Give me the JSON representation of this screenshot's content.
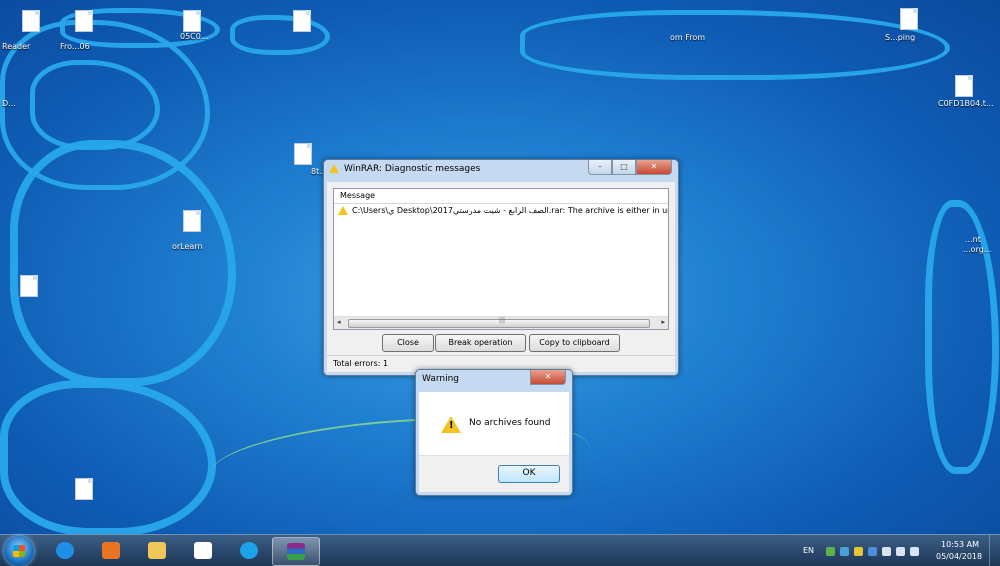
{
  "desktop": {
    "icon_labels": [
      "Reader",
      "Fro...06",
      "05C0...",
      "om From",
      "S...ping",
      "C0FD1B04.t...",
      "D...",
      "8t...",
      "orLearn",
      "...nt",
      "...org..."
    ]
  },
  "diagnostic_window": {
    "title": "WinRAR: Diagnostic messages",
    "minimize": "–",
    "maximize": "□",
    "close": "✕",
    "column_header": "Message",
    "message_row": "C:\\Users\\ي                 Desktop\\الصف الرابع - شيت  مدرستي2017.rar: The archive is either in unk",
    "scroll_left": "◂",
    "scroll_right": "▸",
    "buttons": {
      "close": "Close",
      "break": "Break operation",
      "copy": "Copy to clipboard"
    },
    "status": "Total errors: 1"
  },
  "warning_dialog": {
    "title": "Warning",
    "close": "✕",
    "message": "No archives found",
    "ok": "OK"
  },
  "taskbar": {
    "language": "EN",
    "time": "10:53 AM",
    "date": "05/04/2018"
  },
  "colors": {
    "desktop": "#1f7fd0",
    "accent": "#3c7fb1",
    "scribble": "#28a8ec"
  }
}
